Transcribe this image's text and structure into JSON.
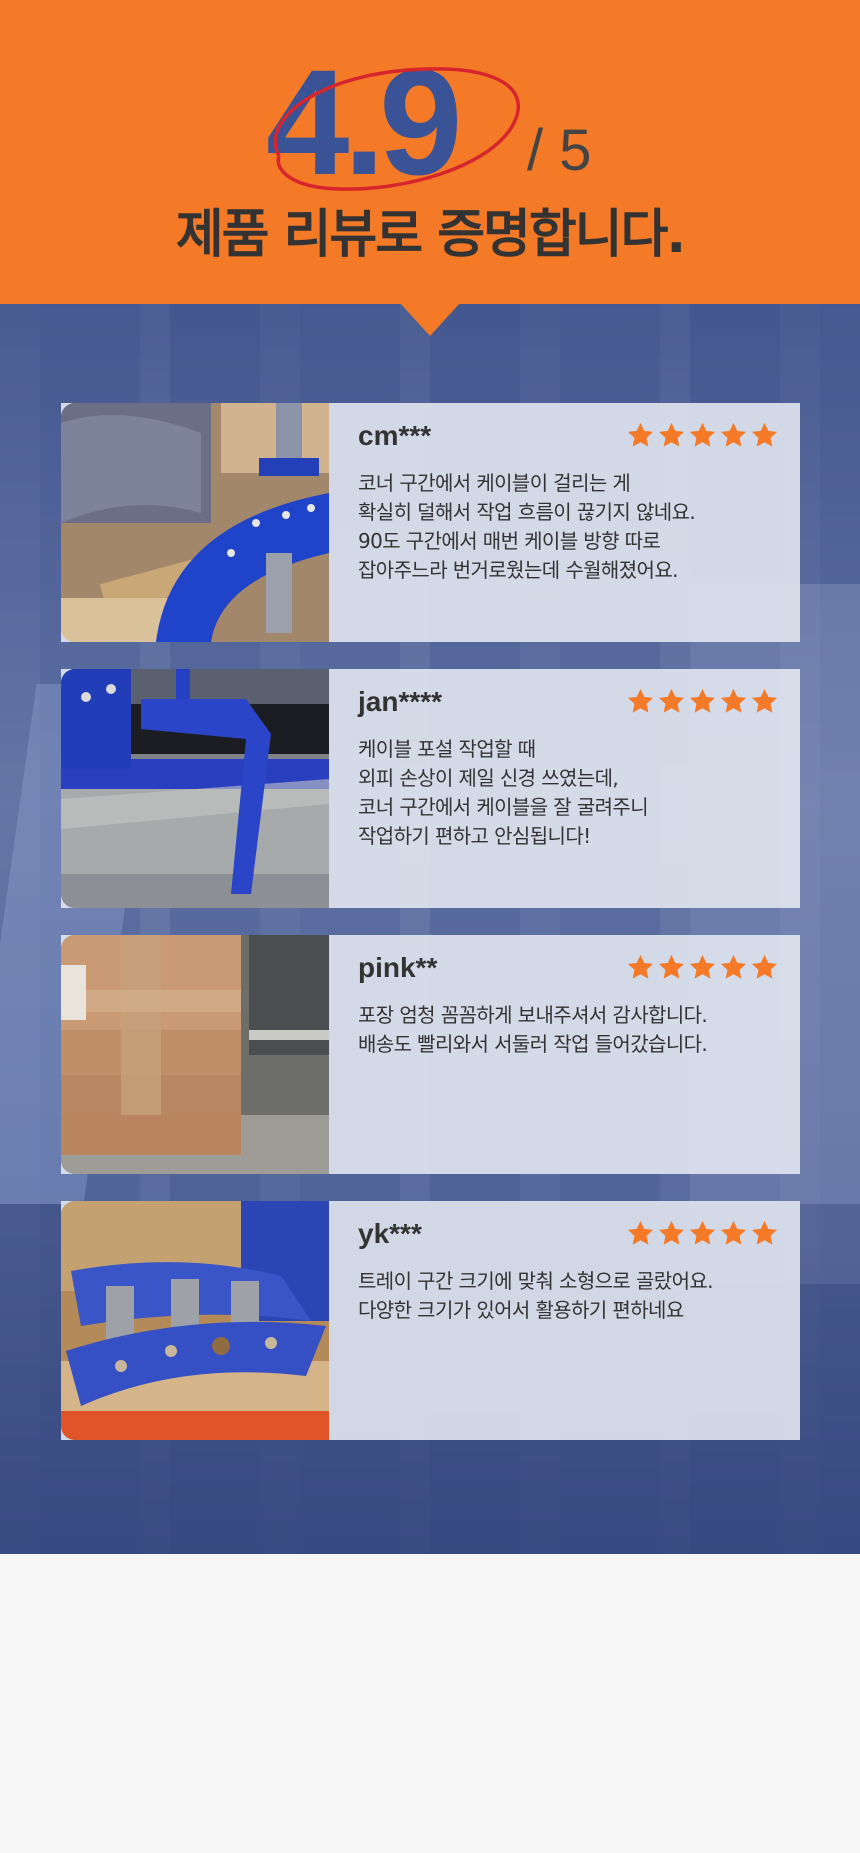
{
  "hero": {
    "score": "4.9",
    "out_of": "/ 5",
    "headline": "제품 리뷰로 증명합니다.",
    "accent_color": "#f47a27",
    "score_color": "#3a5396",
    "circle_color": "#d6252c"
  },
  "reviews": [
    {
      "reviewer": "cm***",
      "rating": 5,
      "lines": [
        "코너 구간에서 케이블이 걸리는 게",
        "확실히 덜해서 작업 흐름이 끊기지 않네요.",
        "90도 구간에서 매번 케이블 방향 따로",
        "잡아주느라 번거로웠는데 수월해졌어요."
      ]
    },
    {
      "reviewer": "jan****",
      "rating": 5,
      "lines": [
        "케이블 포설 작업할 때",
        "외피 손상이 제일 신경 쓰였는데,",
        "코너 구간에서 케이블을 잘 굴려주니",
        "작업하기 편하고 안심됩니다!"
      ]
    },
    {
      "reviewer": "pink**",
      "rating": 5,
      "lines": [
        "포장 엄청 꼼꼼하게 보내주셔서 감사합니다.",
        "배송도 빨리와서 서둘러 작업 들어갔습니다."
      ]
    },
    {
      "reviewer": "yk***",
      "rating": 5,
      "lines": [
        "트레이 구간 크기에 맞춰 소형으로 골랐어요.",
        "다양한 크기가 있어서 활용하기 편하네요"
      ]
    }
  ],
  "star_color": "#f47a27"
}
